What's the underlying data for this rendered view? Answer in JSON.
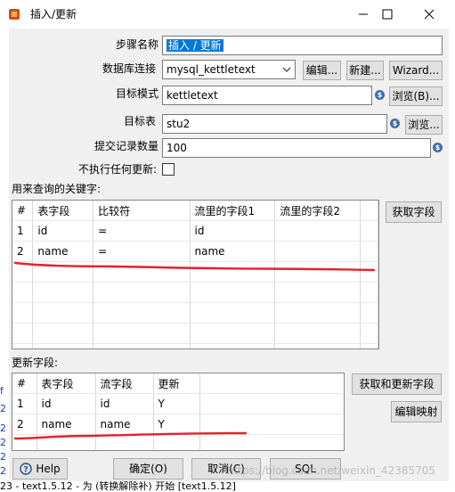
{
  "window": {
    "title": "插入/更新"
  },
  "form": {
    "step_name_label": "步骤名称",
    "step_name_value": "插入 / 更新",
    "connection_label": "数据库连接",
    "connection_value": "mysql_kettletext",
    "edit_button": "编辑...",
    "new_button": "新建...",
    "wizard_button": "Wizard...",
    "schema_label": "目标模式",
    "schema_value": "kettletext",
    "browse_b_button": "浏览(B)...",
    "table_label": "目标表",
    "table_value": "stu2",
    "browse_button": "浏览...",
    "commit_label": "提交记录数量",
    "commit_value": "100",
    "no_update_label": "不执行任何更新:"
  },
  "key_section": {
    "label": "用来查询的关键字:",
    "get_fields_button": "获取字段",
    "columns": [
      "#",
      "表字段",
      "比较符",
      "流里的字段1",
      "流里的字段2"
    ],
    "rows": [
      [
        "1",
        "id",
        "=",
        "id",
        ""
      ],
      [
        "2",
        "name",
        "=",
        "name",
        ""
      ]
    ]
  },
  "update_section": {
    "label": "更新字段:",
    "get_update_fields_button": "获取和更新字段",
    "edit_mapping_button": "编辑映射",
    "columns": [
      "#",
      "表字段",
      "流字段",
      "更新"
    ],
    "rows": [
      [
        "1",
        "id",
        "id",
        "Y"
      ],
      [
        "2",
        "name",
        "name",
        "Y"
      ]
    ]
  },
  "footer": {
    "help_button": "Help",
    "ok_button": "确定(O)",
    "cancel_button": "取消(C)",
    "sql_button": "SQL",
    "watermark": "https://blog.csdn.net/weixin_42385705"
  },
  "background": {
    "left_digits": [
      "2",
      "2",
      "2",
      "2",
      "2",
      "2"
    ],
    "left_bracket": "f",
    "status_text": "23 - text1.5.12 - 为 (转换解除补) 开始 [text1.5.12]"
  },
  "colors": {
    "accent": "#0078d7",
    "annotation": "#e8202a"
  }
}
